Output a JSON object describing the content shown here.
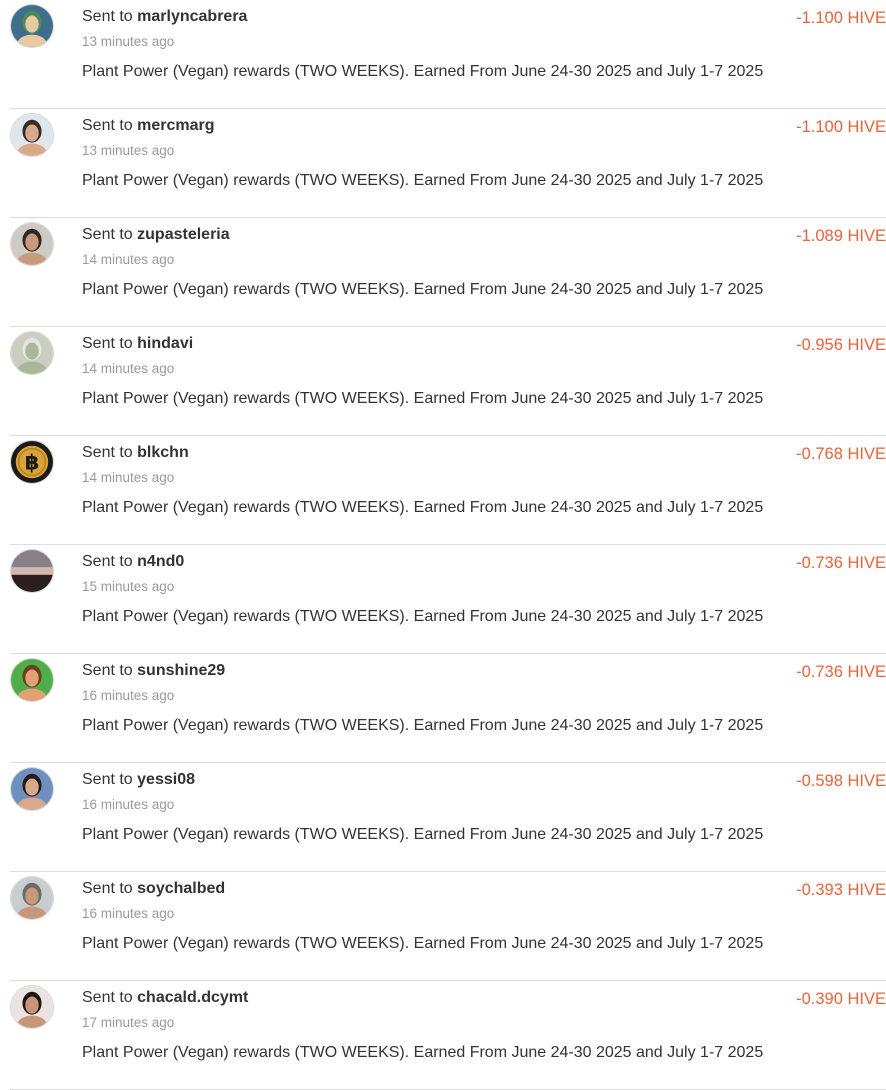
{
  "transfers": [
    {
      "prefix": "Sent to",
      "username": "marlyncabrera",
      "time": "13 minutes ago",
      "memo": "Plant Power (Vegan) rewards (TWO WEEKS). Earned From June 24-30 2025 and July 1-7 2025",
      "amount": "-1.100 HIVE",
      "avatar_icon": "avatar-user-photo-icon",
      "avatar_colors": [
        "#3f6e8c",
        "#e8c9a2",
        "#4b8b55"
      ]
    },
    {
      "prefix": "Sent to",
      "username": "mercmarg",
      "time": "13 minutes ago",
      "memo": "Plant Power (Vegan) rewards (TWO WEEKS). Earned From June 24-30 2025 and July 1-7 2025",
      "amount": "-1.100 HIVE",
      "avatar_icon": "avatar-user-photo-icon",
      "avatar_colors": [
        "#dfe6ea",
        "#d9a98c",
        "#3a2a25"
      ]
    },
    {
      "prefix": "Sent to",
      "username": "zupasteleria",
      "time": "14 minutes ago",
      "memo": "Plant Power (Vegan) rewards (TWO WEEKS). Earned From June 24-30 2025 and July 1-7 2025",
      "amount": "-1.089 HIVE",
      "avatar_icon": "avatar-user-photo-icon",
      "avatar_colors": [
        "#cfcac4",
        "#c99a7c",
        "#2f2622"
      ]
    },
    {
      "prefix": "Sent to",
      "username": "hindavi",
      "time": "14 minutes ago",
      "memo": "Plant Power (Vegan) rewards (TWO WEEKS). Earned From June 24-30 2025 and July 1-7 2025",
      "amount": "-0.956 HIVE",
      "avatar_icon": "avatar-user-photo-icon",
      "avatar_colors": [
        "#c9cfc0",
        "#a9b79a",
        "#e6e3dc"
      ]
    },
    {
      "prefix": "Sent to",
      "username": "blkchn",
      "time": "14 minutes ago",
      "memo": "Plant Power (Vegan) rewards (TWO WEEKS). Earned From June 24-30 2025 and July 1-7 2025",
      "amount": "-0.768 HIVE",
      "avatar_icon": "bitcoin-coin-icon",
      "avatar_colors": [
        "#1c1a17",
        "#d9a23a",
        "#1c1a17"
      ]
    },
    {
      "prefix": "Sent to",
      "username": "n4nd0",
      "time": "15 minutes ago",
      "memo": "Plant Power (Vegan) rewards (TWO WEEKS). Earned From June 24-30 2025 and July 1-7 2025",
      "amount": "-0.736 HIVE",
      "avatar_icon": "avatar-landscape-photo-icon",
      "avatar_colors": [
        "#8a7f86",
        "#d3b8b0",
        "#2b1f22"
      ]
    },
    {
      "prefix": "Sent to",
      "username": "sunshine29",
      "time": "16 minutes ago",
      "memo": "Plant Power (Vegan) rewards (TWO WEEKS). Earned From June 24-30 2025 and July 1-7 2025",
      "amount": "-0.736 HIVE",
      "avatar_icon": "avatar-user-photo-icon",
      "avatar_colors": [
        "#4fae4a",
        "#e2a074",
        "#6b3e22"
      ]
    },
    {
      "prefix": "Sent to",
      "username": "yessi08",
      "time": "16 minutes ago",
      "memo": "Plant Power (Vegan) rewards (TWO WEEKS). Earned From June 24-30 2025 and July 1-7 2025",
      "amount": "-0.598 HIVE",
      "avatar_icon": "avatar-user-photo-icon",
      "avatar_colors": [
        "#6f8fbf",
        "#d8a98a",
        "#241a17"
      ]
    },
    {
      "prefix": "Sent to",
      "username": "soychalbed",
      "time": "16 minutes ago",
      "memo": "Plant Power (Vegan) rewards (TWO WEEKS). Earned From June 24-30 2025 and July 1-7 2025",
      "amount": "-0.393 HIVE",
      "avatar_icon": "avatar-user-photo-icon",
      "avatar_colors": [
        "#c8cdd2",
        "#c8987b",
        "#6e6a66"
      ]
    },
    {
      "prefix": "Sent to",
      "username": "chacald.dcymt",
      "time": "17 minutes ago",
      "memo": "Plant Power (Vegan) rewards (TWO WEEKS). Earned From June 24-30 2025 and July 1-7 2025",
      "amount": "-0.390 HIVE",
      "avatar_icon": "avatar-user-photo-icon",
      "avatar_colors": [
        "#e9e4df",
        "#c9957a",
        "#1d1614"
      ]
    }
  ],
  "colors": {
    "amount_negative": "#e8623a",
    "text": "#333333",
    "muted": "#9a9a9a",
    "divider": "#dcdcdc"
  }
}
